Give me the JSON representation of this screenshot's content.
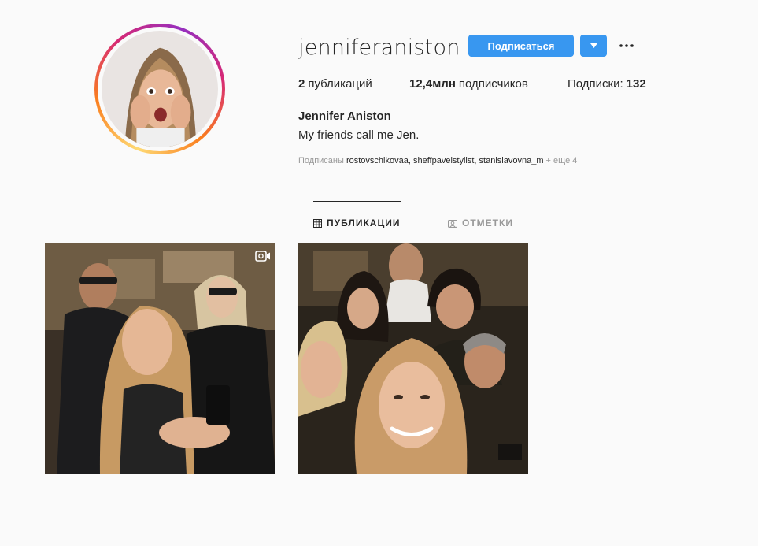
{
  "profile": {
    "username": "jenniferaniston",
    "verified": true,
    "follow_label": "Подписаться",
    "stats": {
      "posts_count": "2",
      "posts_label": "публикаций",
      "followers_count": "12,4млн",
      "followers_label": "подписчиков",
      "following_label": "Подписки:",
      "following_count": "132"
    },
    "full_name": "Jennifer Aniston",
    "bio": "My friends call me Jen.",
    "followed_by": {
      "prefix": "Подписаны",
      "users": [
        "rostovschikovaa,",
        "sheffpavelstylist,",
        "stanislavovna_m"
      ],
      "more": "+ еще 4"
    }
  },
  "tabs": [
    {
      "label": "ПУБЛИКАЦИИ",
      "icon": "grid-icon",
      "active": true
    },
    {
      "label": "ОТМЕТКИ",
      "icon": "tagged-icon",
      "active": false
    }
  ],
  "posts": [
    {
      "type": "video",
      "icon": "video-icon"
    },
    {
      "type": "photo"
    }
  ],
  "colors": {
    "accent": "#3897f0",
    "background": "#fafafa",
    "text": "#262626",
    "muted": "#999999",
    "divider": "#dbdbdb"
  }
}
